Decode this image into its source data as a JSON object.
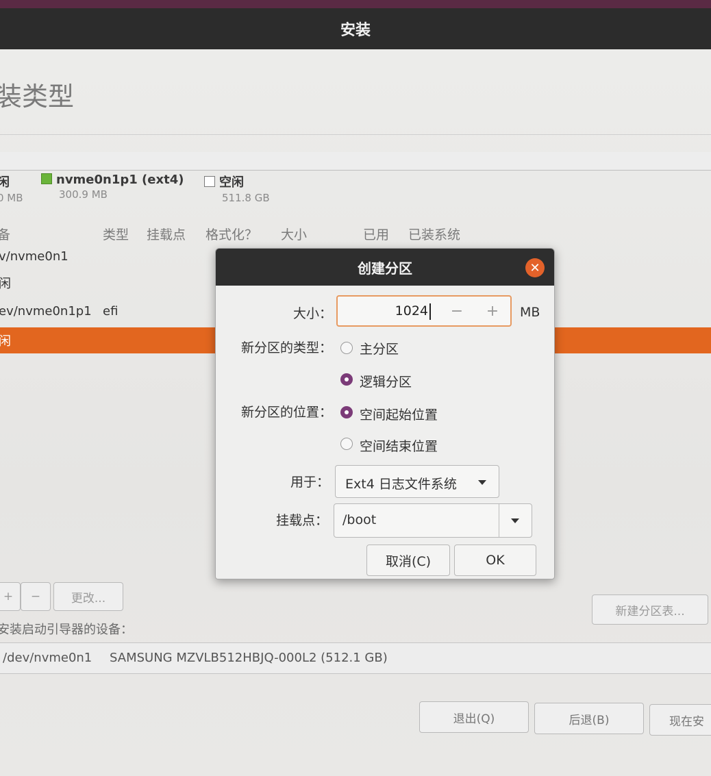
{
  "window": {
    "title": "安装"
  },
  "page": {
    "title": "装类型"
  },
  "disk_legend": [
    {
      "name": "闲",
      "size": "0 MB",
      "swatch": "none"
    },
    {
      "name": "nvme0n1p1 (ext4)",
      "size": "300.9 MB",
      "swatch": "green"
    },
    {
      "name": "空闲",
      "size": "511.8 GB",
      "swatch": "white"
    }
  ],
  "table": {
    "columns": [
      "备",
      "类型",
      "挂载点",
      "格式化？",
      "大小",
      "已用",
      "已装系统"
    ],
    "rows": [
      {
        "device": "v/nvme0n1",
        "type": ""
      },
      {
        "device": "闲",
        "type": ""
      },
      {
        "device": "ev/nvme0n1p1",
        "type": "efi"
      },
      {
        "device": "闲",
        "type": "",
        "selected": true
      }
    ]
  },
  "partition_buttons": {
    "add": "+",
    "remove": "−",
    "change": "更改..."
  },
  "new_table_button": "新建分区表...",
  "bootloader": {
    "label": "安装启动引导器的设备：",
    "device": "/dev/nvme0n1",
    "model": "SAMSUNG MZVLB512HBJQ-000L2 (512.1 GB)"
  },
  "footer": {
    "quit": "退出(Q)",
    "back": "后退(B)",
    "install": "现在安"
  },
  "dialog": {
    "title": "创建分区",
    "size_label": "大小：",
    "size_value": "1024",
    "size_minus": "−",
    "size_plus": "+",
    "size_unit": "MB",
    "type_label": "新分区的类型：",
    "type_options": [
      "主分区",
      "逻辑分区"
    ],
    "type_selected": "逻辑分区",
    "location_label": "新分区的位置：",
    "location_options": [
      "空间起始位置",
      "空间结束位置"
    ],
    "location_selected": "空间起始位置",
    "use_label": "用于：",
    "use_value": "Ext4 日志文件系统",
    "mount_label": "挂载点：",
    "mount_value": "/boot",
    "cancel": "取消(C)",
    "ok": "OK"
  },
  "colors": {
    "accent": "#e2661f",
    "radio": "#7b3b78",
    "close": "#e3622a"
  }
}
